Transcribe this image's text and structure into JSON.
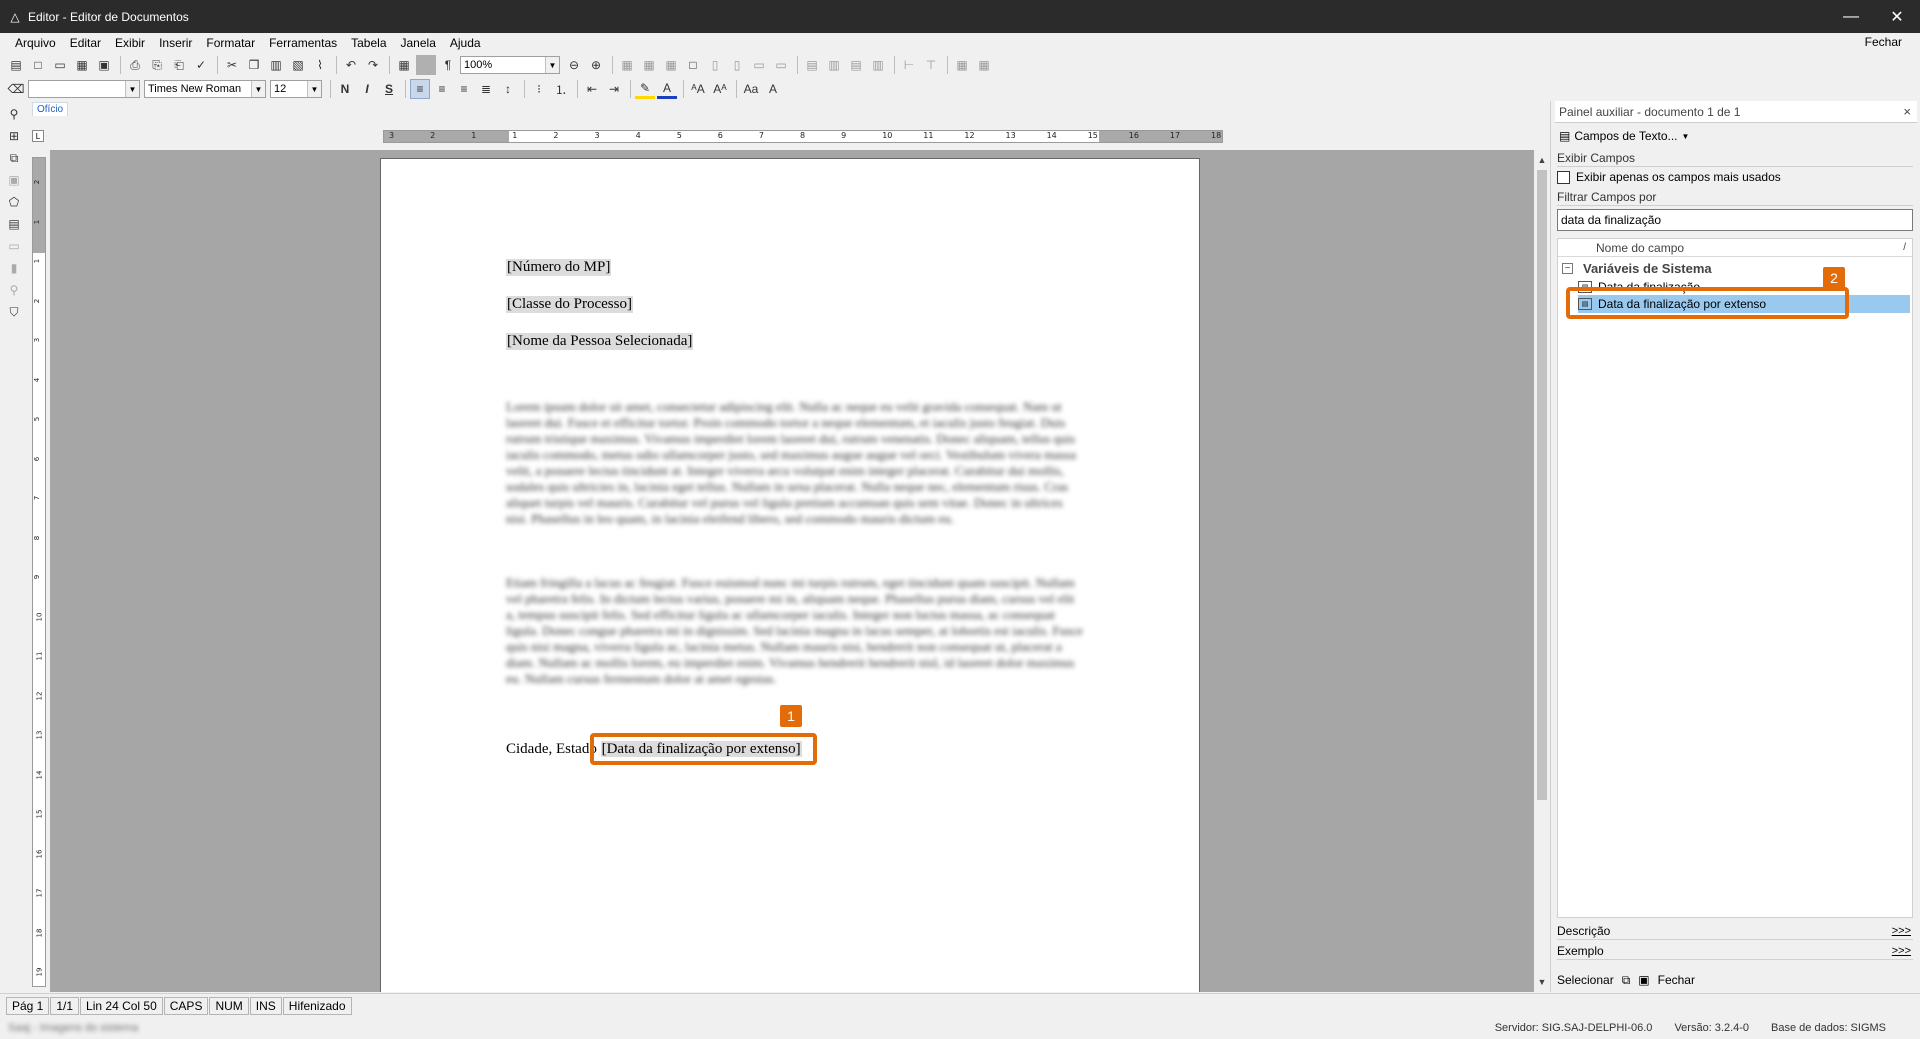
{
  "window": {
    "title": "Editor - Editor de Documentos",
    "minimize": "—",
    "close": "✕"
  },
  "menu": {
    "items": [
      "Arquivo",
      "Editar",
      "Exibir",
      "Inserir",
      "Formatar",
      "Ferramentas",
      "Tabela",
      "Janela",
      "Ajuda"
    ],
    "close_doc": "Fechar"
  },
  "toolbar": {
    "zoom": "100%",
    "font_name": "Times New Roman",
    "font_size": "12",
    "bold": "N",
    "italic": "I",
    "underline": "S"
  },
  "doc_tab": {
    "label": "Ofício"
  },
  "ruler": {
    "h_ticks": [
      "3",
      "2",
      "1",
      "1",
      "2",
      "3",
      "4",
      "5",
      "6",
      "7",
      "8",
      "9",
      "10",
      "11",
      "12",
      "13",
      "14",
      "15",
      "16",
      "17",
      "18"
    ],
    "v_ticks": [
      "2",
      "1",
      "1",
      "2",
      "3",
      "4",
      "5",
      "6",
      "7",
      "8",
      "9",
      "10",
      "11",
      "12",
      "13",
      "14",
      "15",
      "16",
      "17",
      "18",
      "19"
    ]
  },
  "document": {
    "fields": [
      "[Número do MP]",
      "[Classe do Processo]",
      "[Nome da Pessoa Selecionada]"
    ],
    "paragraph1": "Lorem ipsum dolor sit amet, consectetur adipiscing elit. Nulla ac neque eu velit gravida consequat. Nam ut laoreet dui. Fusce et efficitur tortor. Proin commodo tortor a neque elementum, et iaculis justo feugiat. Duis rutrum tristique maximus. Vivamus imperdiet lorem laoreet dui, rutrum venenatis. Donec aliquam, tellus quis iaculis commodo, metus odio ullamcorper justo, sed maximus augue augue vel orci. Vestibulum vivera massa velit, a posuere lectus tincidunt at. Integer viverra arcu volutpat enim integer placerat. Curabitur dui mollis, sodales quis ultricies in, lacinia eget tellus. Nullam in urna placerat. Nulla neque nec, elementum risus. Cras aliquet turpis vel mauris. Curabitur vel purus vel ligula pretium accumsan quis sem vitae. Donec in ultrices nisi. Phasellus in leo quam, in lacinia eleifend libero, sed commodo mauris dictum eu.",
    "paragraph2": "Etiam fringilla a lacus ac feugiat. Fusce euismod nunc mi turpis rutrum, eget tincidunt quam suscipit. Nullam vel pharetra felis. In dictum lectus varius, posuere mi in, aliquam neque. Phasellus purus diam, cursus vel elit a, tempus suscipit felis. Sed efficitur ligula ac ullamcorper iaculis. Integer non luctus massa, ac consequat ligula. Donec congue pharetra mi in dignissim. Sed lacinia magna in lacus semper, at lobortis est iaculis. Fusce quis nisi magna, viverra ligula ac, lacinia metus. Nullam mauris nisi, hendrerit non consequat ut, placerat a diam. Nullam ac mollis lorem, eu imperdiet enim. Vivamus hendrerit hendrerit nisl, id laoreet dolor maximus eu. Nullam cursus fermentum dolor at amet egestas.",
    "city_label": "Cidade, Estado",
    "city_field": "[Data da finalização por extenso]"
  },
  "annotations": {
    "badge1": "1",
    "badge2": "2",
    "accent_color": "#e36c09"
  },
  "side_panel": {
    "title": "Painel auxiliar - documento 1 de 1",
    "close": "×",
    "dropdown_label": "Campos de Texto...",
    "exibir_campos": "Exibir Campos",
    "checkbox_label": "Exibir apenas os campos mais usados",
    "filtrar_label": "Filtrar Campos por",
    "filter_value": "data da finalização",
    "column_header": "Nome do campo",
    "sort_icon": "/",
    "group_label": "Variáveis de Sistema",
    "group_toggle": "−",
    "items": [
      "Data da finalização",
      "Data da finalização por extenso"
    ],
    "descricao": "Descrição",
    "exemplo": "Exemplo",
    "more": ">>>",
    "selecionar": "Selecionar",
    "fechar": "Fechar",
    "selected_color": "#99c9ef"
  },
  "status": {
    "cells": [
      "Pág 1",
      "1/1",
      "Lin 24  Col 50",
      "CAPS",
      "NUM",
      "INS",
      "Hifenizado"
    ]
  },
  "bottom": {
    "left": "Saaj - Imagens do sistema",
    "servidor": "Servidor: SIG.SAJ-DELPHI-06.0",
    "versao": "Versão: 3.2.4-0",
    "base": "Base de dados: SIGMS"
  }
}
